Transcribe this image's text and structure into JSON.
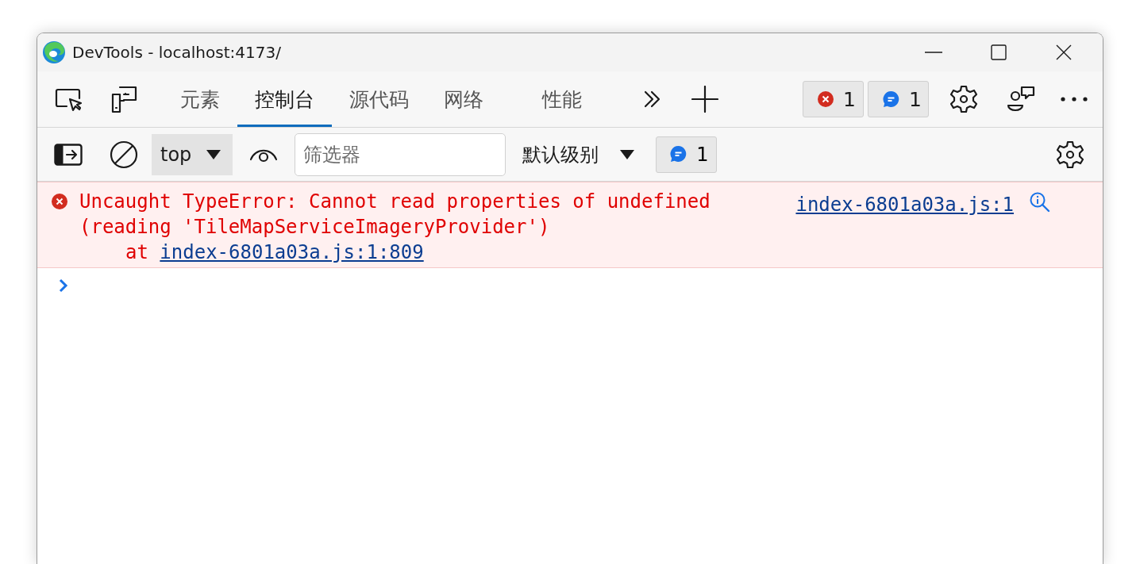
{
  "window": {
    "title": "DevTools - localhost:4173/"
  },
  "tabs": [
    {
      "label": "元素",
      "selected": false
    },
    {
      "label": "控制台",
      "selected": true
    },
    {
      "label": "源代码",
      "selected": false
    },
    {
      "label": "网络",
      "selected": false
    },
    {
      "label": "性能",
      "selected": false
    }
  ],
  "counters": [
    {
      "kind": "error",
      "count": "1"
    },
    {
      "kind": "issue",
      "count": "1"
    }
  ],
  "console_toolbar": {
    "context": "top",
    "filter": {
      "placeholder": "筛选器"
    },
    "level": "默认级别",
    "issues": "1"
  },
  "messages": [
    {
      "kind": "error",
      "lines": [
        "Uncaught TypeError: Cannot read properties of undefined",
        "(reading 'TileMapServiceImageryProvider')"
      ],
      "stack": {
        "prefix": "at",
        "link": "index-6801a03a.js:1:809"
      },
      "source": "index-6801a03a.js:1"
    }
  ]
}
